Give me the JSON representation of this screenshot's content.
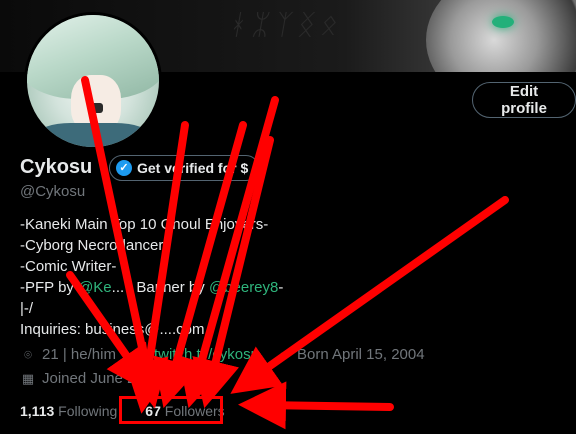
{
  "profile": {
    "display_name": "Cykosu",
    "handle": "@Cykosu",
    "verify_label": "Get verified for $",
    "edit_label": "Edit profile",
    "bio": [
      "-Kaneki Main Top 10 Ghoul Enjoyers-",
      "-Cyborg Necrodancer-",
      "-Comic Writer-",
      "-PFP by @Kei... | Banner by @beerey8-",
      "|-/",
      "Inquiries: business@....com"
    ],
    "bio_link_pfp": "@Ke",
    "bio_link_banner": "@beerey8",
    "meta": {
      "age_pronouns": "21 | he/him",
      "website": "twitch.tv/cykosu",
      "born": "Born April 15, 2004",
      "joined": "Joined June 2018"
    },
    "stats": {
      "following_count": "1,113",
      "following_label": "Following",
      "followers_count": "67",
      "followers_label": "Followers"
    }
  },
  "colors": {
    "accent": "#1d9bf0",
    "annotation_red": "#ff0000",
    "link_green": "#2fb47c"
  },
  "icons": [
    "location-icon",
    "link-icon",
    "balloon-icon",
    "calendar-icon",
    "verified-badge-icon"
  ]
}
